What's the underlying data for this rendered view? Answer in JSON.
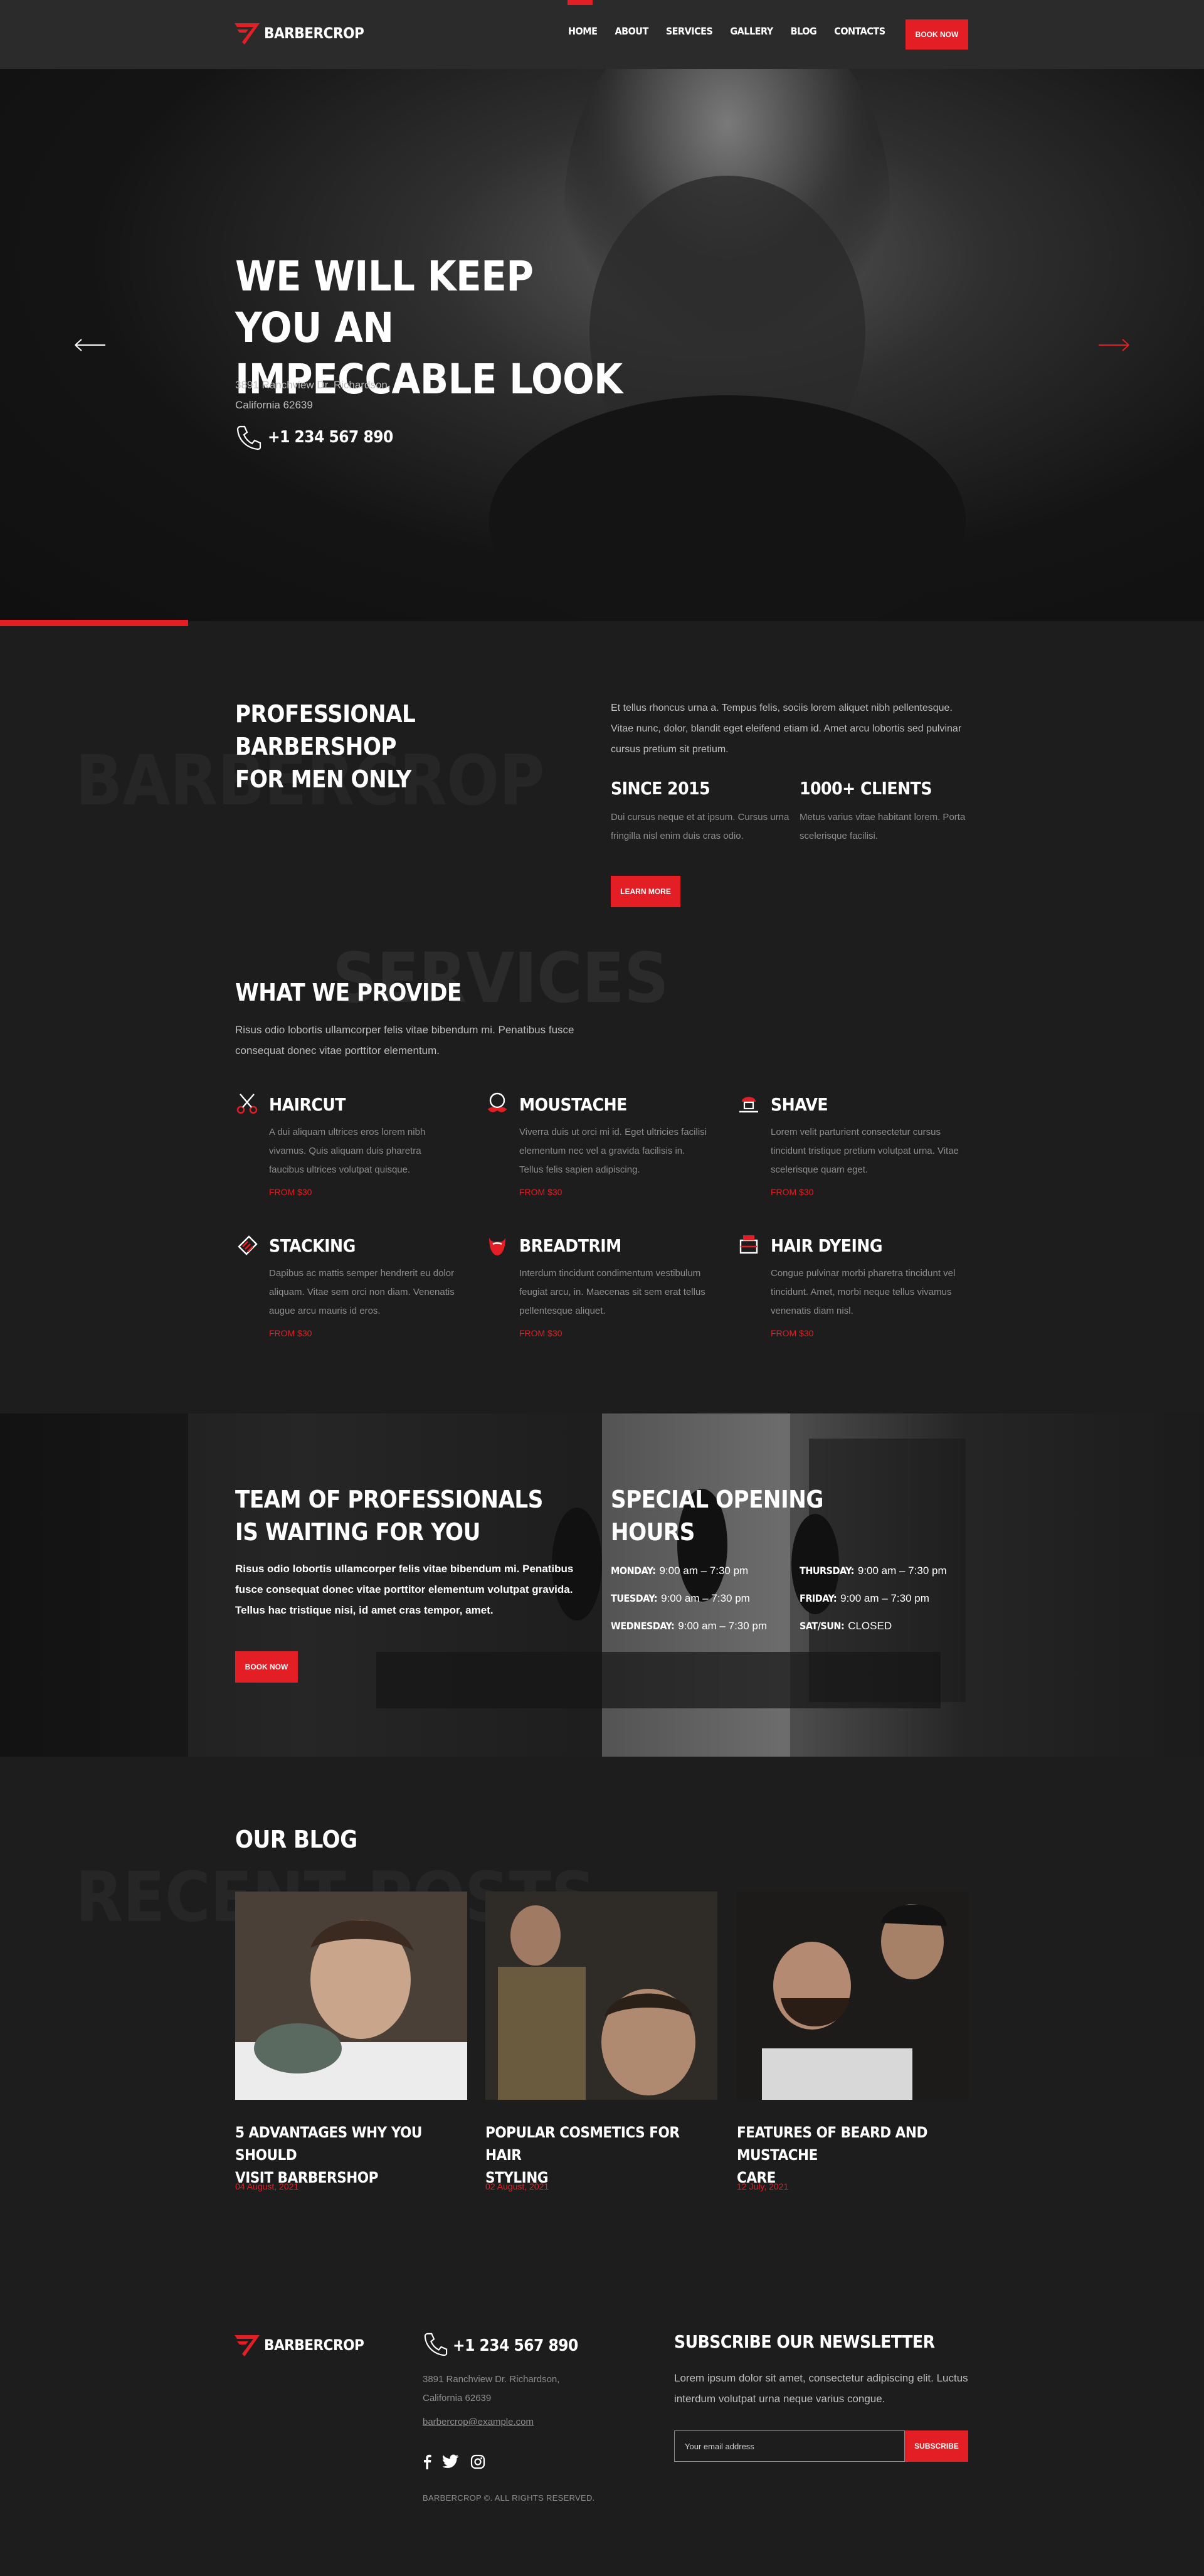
{
  "brand": {
    "name": "BARBERCROP",
    "accent": "#e31e24",
    "background": "#1d1d1d"
  },
  "header": {
    "nav": [
      "HOME",
      "ABOUT",
      "SERVICES",
      "GALLERY",
      "BLOG",
      "CONTACTS"
    ],
    "active_nav": "HOME",
    "book_now": "BOOK NOW"
  },
  "hero": {
    "title_line1": "WE WILL KEEP YOU AN",
    "title_line2": "IMPECCABLE LOOK",
    "address_line1": "3891 Ranchview Dr. Richardson,",
    "address_line2": "California 62639",
    "phone": "+1 234 567 890",
    "prev_icon": "arrow-left-icon",
    "next_icon": "arrow-right-icon"
  },
  "about": {
    "watermark": "BARBERCROP",
    "title_line1": "PROFESSIONAL BARBERSHOP",
    "title_line2": "FOR MEN ONLY",
    "text": "Et tellus rhoncus urna a. Tempus felis, sociis lorem aliquet nibh pellentesque. Vitae nunc, dolor, blandit eget eleifend etiam id. Amet arcu lobortis sed pulvinar cursus pretium sit pretium.",
    "since_title": "SINCE 2015",
    "since_text": "Dui cursus neque et at ipsum. Cursus urna fringilla nisl enim duis cras odio.",
    "clients_title": "1000+ CLIENTS",
    "clients_text": "Metus varius vitae habitant lorem. Porta scelerisque facilisi.",
    "learn_more": "LEARN MORE"
  },
  "services": {
    "watermark": "SERVICES",
    "title": "WHAT WE PROVIDE",
    "intro": "Risus odio lobortis ullamcorper felis vitae bibendum mi. Penatibus fusce consequat donec vitae porttitor elementum.",
    "items": [
      {
        "name": "HAIRCUT",
        "icon": "scissors-comb-icon",
        "text": "A dui aliquam ultrices eros lorem nibh vivamus. Quis aliquam duis pharetra faucibus ultrices volutpat quisque.",
        "price": "FROM $30"
      },
      {
        "name": "MOUSTACHE",
        "icon": "moustache-icon",
        "text": "Viverra duis ut orci mi id. Eget ultricies facilisi elementum nec vel a gravida facilisis in. Tellus felis sapien adipiscing.",
        "price": "FROM $30"
      },
      {
        "name": "SHAVE",
        "icon": "shaving-brush-icon",
        "text": "Lorem velit parturient consectetur cursus tincidunt tristique pretium volutpat urna. Vitae scelerisque quam eget.",
        "price": "FROM $30"
      },
      {
        "name": "STACKING",
        "icon": "hair-comb-icon",
        "text": "Dapibus ac mattis semper hendrerit eu dolor aliquam. Vitae sem orci non diam. Venenatis augue arcu mauris id eros.",
        "price": "FROM $30"
      },
      {
        "name": "BREADTRIM",
        "icon": "beard-icon",
        "text": "Interdum tincidunt condimentum vestibulum feugiat arcu, in. Maecenas sit sem erat tellus pellentesque aliquet.",
        "price": "FROM $30"
      },
      {
        "name": "HAIR DYEING",
        "icon": "dye-bottle-icon",
        "text": "Congue pulvinar morbi pharetra tincidunt vel tincidunt. Amet, morbi neque tellus vivamus venenatis diam nisl.",
        "price": "FROM $30"
      }
    ]
  },
  "team": {
    "title_line1": "TEAM OF PROFESSIONALS",
    "title_line2": "IS WAITING FOR YOU",
    "text": "Risus odio lobortis ullamcorper felis vitae bibendum mi. Penatibus fusce consequat donec vitae porttitor elementum volutpat gravida. Tellus hac tristique nisi, id amet cras tempor, amet.",
    "button": "BOOK NOW"
  },
  "hours": {
    "title_line1": "SPECIAL OPENING",
    "title_line2": "HOURS",
    "rows": [
      {
        "day": "MONDAY:",
        "time": "9:00 am – 7:30 pm"
      },
      {
        "day": "TUESDAY:",
        "time": "9:00 am – 7:30 pm"
      },
      {
        "day": "WEDNESDAY:",
        "time": "9:00 am – 7:30 pm"
      },
      {
        "day": "THURSDAY:",
        "time": "9:00 am – 7:30 pm"
      },
      {
        "day": "FRIDAY:",
        "time": "9:00 am – 7:30 pm"
      },
      {
        "day": "SAT/SUN:",
        "time": "CLOSED"
      }
    ]
  },
  "blog": {
    "watermark": "RECENT POSTS",
    "title": "OUR BLOG",
    "posts": [
      {
        "title_line1": "5 ADVANTAGES WHY YOU SHOULD",
        "title_line2": "VISIT BARBERSHOP",
        "date": "04 August, 2021"
      },
      {
        "title_line1": "POPULAR COSMETICS FOR HAIR",
        "title_line2": "STYLING",
        "date": "02 August, 2021"
      },
      {
        "title_line1": "FEATURES OF BEARD AND MUSTACHE",
        "title_line2": "CARE",
        "date": "12 July, 2021"
      }
    ]
  },
  "footer": {
    "phone": "+1 234 567 890",
    "address_line1": "3891 Ranchview Dr. Richardson,",
    "address_line2": "California 62639",
    "email": "barbercrop@example.com",
    "social": [
      "facebook-icon",
      "twitter-icon",
      "instagram-icon"
    ],
    "copyright": "BARBERCROP ©. ALL RIGHTS RESERVED.",
    "newsletter_title": "SUBSCRIBE OUR NEWSLETTER",
    "newsletter_text": "Lorem ipsum dolor sit amet, consectetur adipiscing elit. Luctus interdum volutpat urna neque varius congue.",
    "email_placeholder": "Your email address",
    "subscribe": "SUBSCRIBE"
  }
}
